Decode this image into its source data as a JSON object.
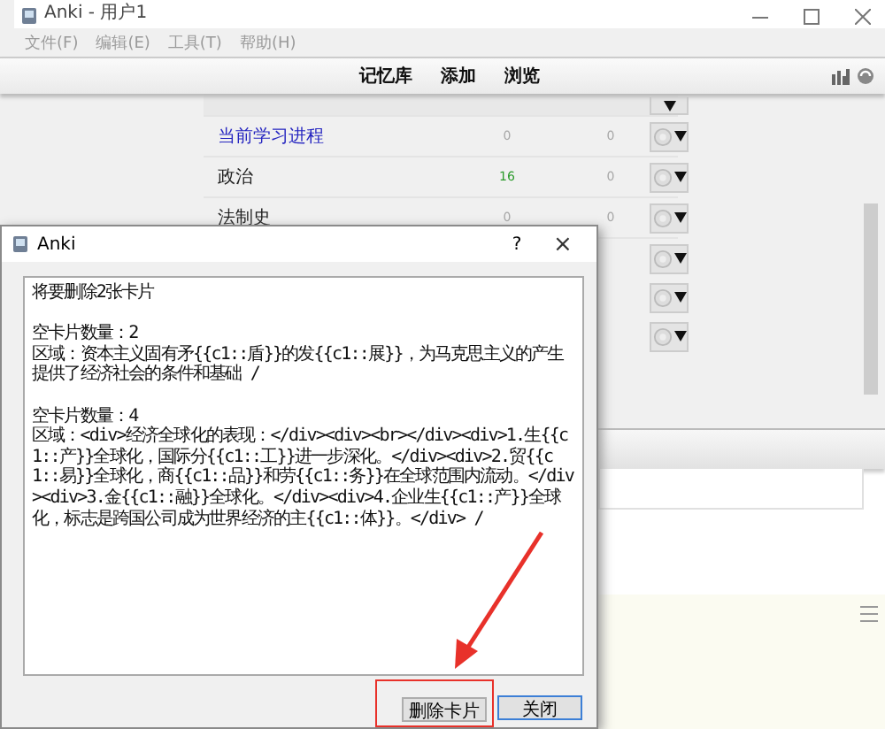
{
  "main_window": {
    "title": "Anki - 用户1"
  },
  "menu": [
    {
      "label": "文件(F)",
      "disabled": true
    },
    {
      "label": "编辑(E)",
      "disabled": true
    },
    {
      "label": "工具(T)",
      "disabled": true
    },
    {
      "label": "帮助(H)",
      "disabled": true
    }
  ],
  "toolbar": [
    "记忆库",
    "添加",
    "浏览"
  ],
  "decks": [
    {
      "name": "当前学习进程",
      "current": true,
      "due": "0",
      "due_active": false,
      "new": "0"
    },
    {
      "name": "政治",
      "current": false,
      "due": "16",
      "due_active": true,
      "new": "0"
    },
    {
      "name": "法制史",
      "current": false,
      "due": "0",
      "due_active": false,
      "new": "0"
    }
  ],
  "dialog": {
    "title": "Anki",
    "help": "?",
    "close": "×",
    "message": [
      {
        "kind": "summary",
        "text": "将要删除2张卡片"
      },
      {
        "kind": "count",
        "text": "空卡片数量：2"
      },
      {
        "kind": "field",
        "text": "区域：资本主义固有矛{{c1::盾}}的发{{c1::展}}，为马克思主义的产生提供了经济社会的条件和基础 /"
      },
      {
        "kind": "count",
        "text": "空卡片数量：4"
      },
      {
        "kind": "field",
        "text": "区域：<div>经济全球化的表现：</div><div><br></div><div>1.生{{c1::产}}全球化，国际分{{c1::工}}进一步深化。</div><div>2.贸{{c1::易}}全球化，商{{c1::品}}和劳{{c1::务}}在全球范围内流动。</div><div>3.金{{c1::融}}全球化。</div><div>4.企业生{{c1::产}}全球化，标志是跨国公司成为世界经济的主{{c1::体}}。</div> /"
      }
    ],
    "buttons": [
      {
        "label": "删除卡片",
        "highlighted": true
      },
      {
        "label": "关闭",
        "highlighted": false
      }
    ]
  }
}
